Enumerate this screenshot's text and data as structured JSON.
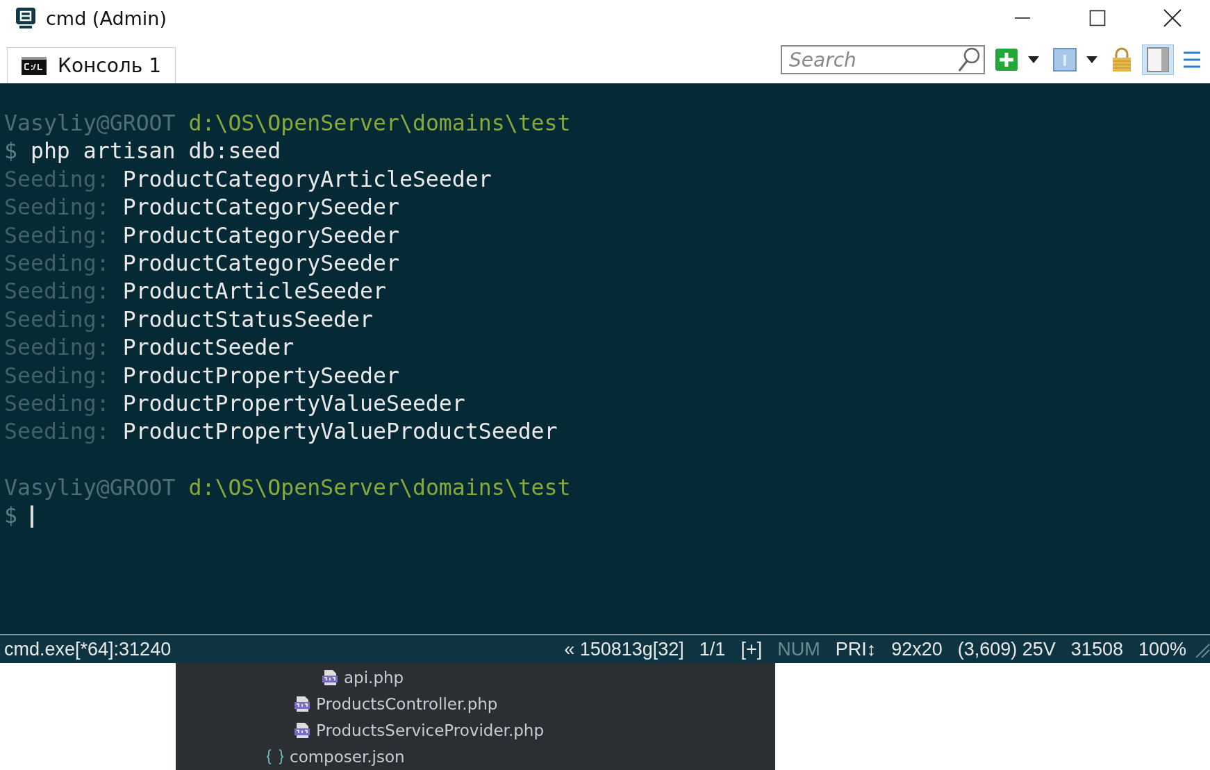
{
  "window": {
    "title": "cmd (Admin)"
  },
  "tabs": [
    {
      "label": "Консоль 1",
      "selected": true
    }
  ],
  "search": {
    "placeholder": "Search"
  },
  "terminal": {
    "lines": [
      {
        "kind": "prompt",
        "user": "Vasyliy@GROOT",
        "path": "d:\\OS\\OpenServer\\domains\\test"
      },
      {
        "kind": "command",
        "prompt": "$",
        "text": "php artisan db:seed"
      },
      {
        "kind": "output",
        "label": "Seeding:",
        "text": "ProductCategoryArticleSeeder"
      },
      {
        "kind": "output",
        "label": "Seeding:",
        "text": "ProductCategorySeeder"
      },
      {
        "kind": "output",
        "label": "Seeding:",
        "text": "ProductCategorySeeder"
      },
      {
        "kind": "output",
        "label": "Seeding:",
        "text": "ProductCategorySeeder"
      },
      {
        "kind": "output",
        "label": "Seeding:",
        "text": "ProductArticleSeeder"
      },
      {
        "kind": "output",
        "label": "Seeding:",
        "text": "ProductStatusSeeder"
      },
      {
        "kind": "output",
        "label": "Seeding:",
        "text": "ProductSeeder"
      },
      {
        "kind": "output",
        "label": "Seeding:",
        "text": "ProductPropertySeeder"
      },
      {
        "kind": "output",
        "label": "Seeding:",
        "text": "ProductPropertyValueSeeder"
      },
      {
        "kind": "output",
        "label": "Seeding:",
        "text": "ProductPropertyValueProductSeeder"
      },
      {
        "kind": "blank"
      },
      {
        "kind": "prompt",
        "user": "Vasyliy@GROOT",
        "path": "d:\\OS\\OpenServer\\domains\\test"
      },
      {
        "kind": "input",
        "prompt": "$",
        "cursor": true
      }
    ]
  },
  "status_bar": {
    "process": "cmd.exe[*64]:31240",
    "items": [
      {
        "text": "« 150813g[32]",
        "disabled": false
      },
      {
        "text": "1/1",
        "disabled": false
      },
      {
        "text": "[+]",
        "disabled": false
      },
      {
        "text": "NUM",
        "disabled": true
      },
      {
        "text": "PRI↕",
        "disabled": false
      },
      {
        "text": "92x20",
        "disabled": false
      },
      {
        "text": "(3,609) 25V",
        "disabled": false
      },
      {
        "text": "31508",
        "disabled": false
      },
      {
        "text": "100%",
        "disabled": false
      }
    ]
  },
  "file_tree": {
    "items": [
      {
        "kind": "group",
        "children": [
          {
            "kind": "group",
            "children": [
              {
                "kind": "php",
                "name": "api.php"
              }
            ]
          },
          {
            "kind": "php",
            "name": "ProductsController.php"
          },
          {
            "kind": "php",
            "name": "ProductsServiceProvider.php"
          }
        ]
      },
      {
        "kind": "json",
        "name": "composer.json"
      }
    ]
  }
}
